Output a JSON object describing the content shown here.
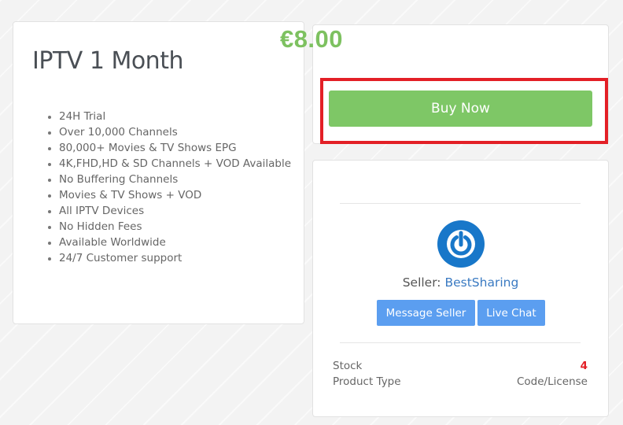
{
  "product": {
    "title": "IPTV 1 Month",
    "features": [
      "24H Trial",
      "Over 10,000 Channels",
      "80,000+ Movies & TV Shows EPG",
      "4K,FHD,HD & SD Channels + VOD Available",
      "No Buffering Channels",
      "Movies & TV Shows + VOD",
      "All IPTV Devices",
      "No Hidden Fees",
      "Available Worldwide",
      "24/7 Customer support"
    ]
  },
  "purchase": {
    "price": "€8.00",
    "buy_label": "Buy Now"
  },
  "seller": {
    "prefix": "Seller: ",
    "name": "BestSharing",
    "avatar_icon": "power-icon",
    "message_label": "Message Seller",
    "chat_label": "Live Chat"
  },
  "details": {
    "stock_label": "Stock",
    "stock_value": "4",
    "type_label": "Product Type",
    "type_value": "Code/License"
  },
  "colors": {
    "price_green": "#7dc160",
    "buy_button": "#7ec766",
    "highlight_red": "#e31f26",
    "seller_buttons": "#5b9ef0",
    "avatar_blue": "#1877c9",
    "link_blue": "#3a7ac2"
  }
}
